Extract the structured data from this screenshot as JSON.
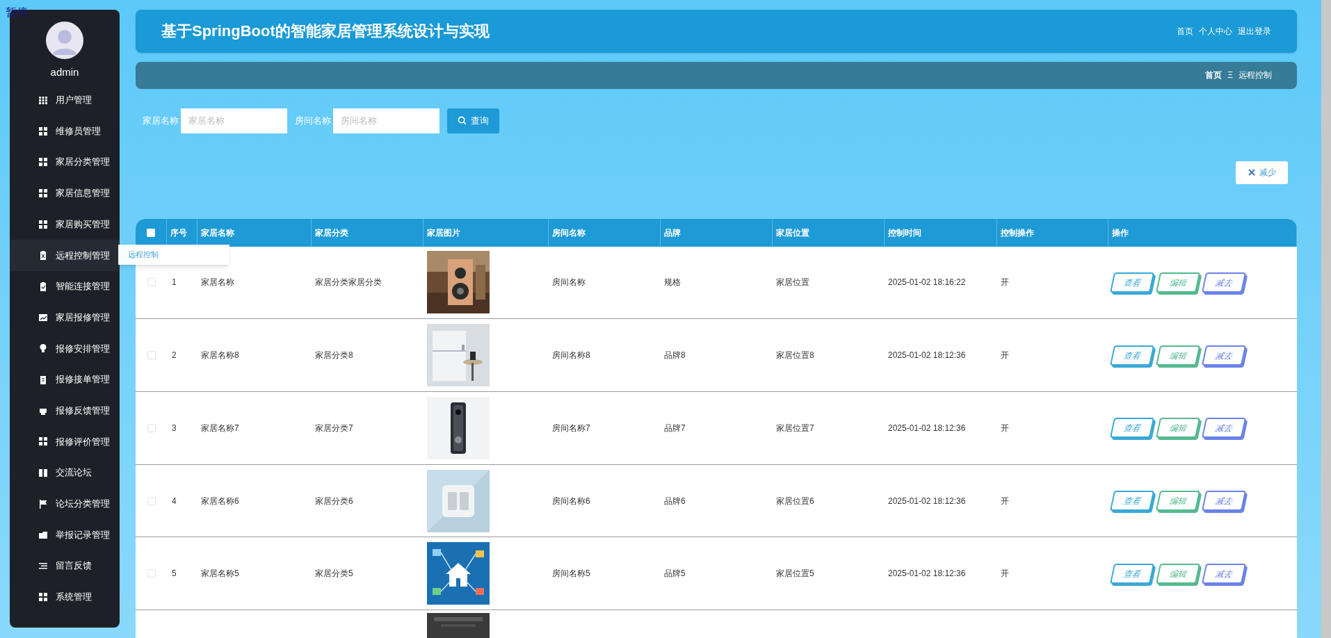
{
  "overlay_label": "暂停",
  "sidebar": {
    "username": "admin",
    "items": [
      {
        "label": "用户管理",
        "selected": false
      },
      {
        "label": "维修员管理",
        "selected": false
      },
      {
        "label": "家居分类管理",
        "selected": false
      },
      {
        "label": "家居信息管理",
        "selected": false
      },
      {
        "label": "家居购买管理",
        "selected": false
      },
      {
        "label": "远程控制管理",
        "selected": true,
        "submenu": [
          "远程控制"
        ]
      },
      {
        "label": "智能连接管理",
        "selected": false
      },
      {
        "label": "家居报修管理",
        "selected": false
      },
      {
        "label": "报修安排管理",
        "selected": false
      },
      {
        "label": "报修接单管理",
        "selected": false
      },
      {
        "label": "报修反馈管理",
        "selected": false
      },
      {
        "label": "报修评价管理",
        "selected": false
      },
      {
        "label": "交流论坛",
        "selected": false
      },
      {
        "label": "论坛分类管理",
        "selected": false
      },
      {
        "label": "举报记录管理",
        "selected": false
      },
      {
        "label": "留言反馈",
        "selected": false
      },
      {
        "label": "系统管理",
        "selected": false
      }
    ]
  },
  "header": {
    "title": "基于SpringBoot的智能家居管理系统设计与实现",
    "links": [
      "首页",
      "个人中心",
      "退出登录"
    ]
  },
  "breadcrumb": {
    "home": "首页",
    "separator": "Ξ",
    "current": "远程控制"
  },
  "search": {
    "fields": [
      {
        "label": "家居名称",
        "placeholder": "家居名称"
      },
      {
        "label": "房间名称",
        "placeholder": "房间名称"
      }
    ],
    "button": "查询"
  },
  "toolbar": {
    "button": "减少"
  },
  "table": {
    "header_checked": false,
    "columns": [
      "序号",
      "家居名称",
      "家居分类",
      "家居图片",
      "房间名称",
      "品牌",
      "家居位置",
      "控制时间",
      "控制操作",
      "操作"
    ],
    "rows": [
      {
        "checked": false,
        "cells": [
          "1",
          "家居名称",
          "家居分类家居分类",
          "",
          "房间名称",
          "规格",
          "家居位置",
          "2025-01-02 18:16:22",
          "开"
        ],
        "actions": [
          {
            "kind": "view",
            "label": "查看"
          },
          {
            "kind": "edit",
            "label": "编辑"
          },
          {
            "kind": "delete",
            "label": "减去"
          }
        ]
      },
      {
        "checked": false,
        "cells": [
          "2",
          "家居名称8",
          "家居分类8",
          "",
          "房间名称8",
          "品牌8",
          "家居位置8",
          "2025-01-02 18:12:36",
          "开"
        ],
        "actions": [
          {
            "kind": "view",
            "label": "查看"
          },
          {
            "kind": "edit",
            "label": "编辑"
          },
          {
            "kind": "delete",
            "label": "减去"
          }
        ]
      },
      {
        "checked": false,
        "cells": [
          "3",
          "家居名称7",
          "家居分类7",
          "",
          "房间名称7",
          "品牌7",
          "家居位置7",
          "2025-01-02 18:12:36",
          "开"
        ],
        "actions": [
          {
            "kind": "view",
            "label": "查看"
          },
          {
            "kind": "edit",
            "label": "编辑"
          },
          {
            "kind": "delete",
            "label": "减去"
          }
        ]
      },
      {
        "checked": false,
        "cells": [
          "4",
          "家居名称6",
          "家居分类6",
          "",
          "房间名称6",
          "品牌6",
          "家居位置6",
          "2025-01-02 18:12:36",
          "开"
        ],
        "actions": [
          {
            "kind": "view",
            "label": "查看"
          },
          {
            "kind": "edit",
            "label": "编辑"
          },
          {
            "kind": "delete",
            "label": "减去"
          }
        ]
      },
      {
        "checked": false,
        "cells": [
          "5",
          "家居名称5",
          "家居分类5",
          "",
          "房间名称5",
          "品牌5",
          "家居位置5",
          "2025-01-02 18:12:36",
          "开"
        ],
        "actions": [
          {
            "kind": "view",
            "label": "查看"
          },
          {
            "kind": "edit",
            "label": "编辑"
          },
          {
            "kind": "delete",
            "label": "减去"
          }
        ]
      }
    ]
  }
}
